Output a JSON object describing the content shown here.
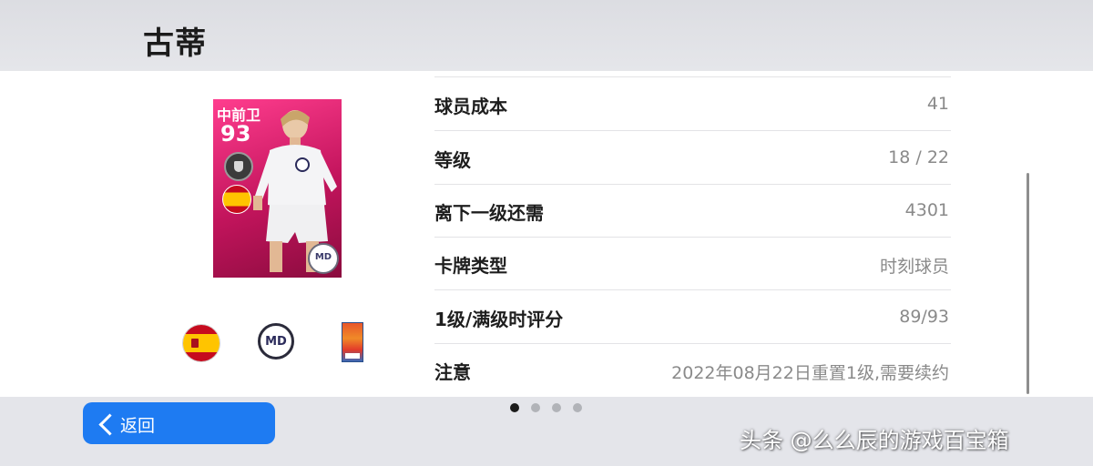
{
  "header": {
    "player_name": "古蒂"
  },
  "card": {
    "position": "中前卫",
    "rating": "93",
    "card_color": "#e0226d",
    "club_badge_text": "MD"
  },
  "attributes": {
    "nationality_icon": "spain-flag-icon",
    "club_icon": "club-crest-icon",
    "club_text": "MD",
    "league_icon": "league-icon"
  },
  "info_rows": [
    {
      "label": "球员成本",
      "value": "41"
    },
    {
      "label": "等级",
      "value": "18 / 22"
    },
    {
      "label": "离下一级还需",
      "value": "4301"
    },
    {
      "label": "卡牌类型",
      "value": "时刻球员"
    },
    {
      "label": "1级/满级时评分",
      "value": "89/93"
    },
    {
      "label": "注意",
      "value": "2022年08月22日重置1级,需要续约"
    }
  ],
  "pager": {
    "pages": 4,
    "active": 1
  },
  "footer": {
    "back_label": "返回",
    "accent_color": "#1e7bf2"
  },
  "watermark": "头条 @么么辰的游戏百宝箱"
}
